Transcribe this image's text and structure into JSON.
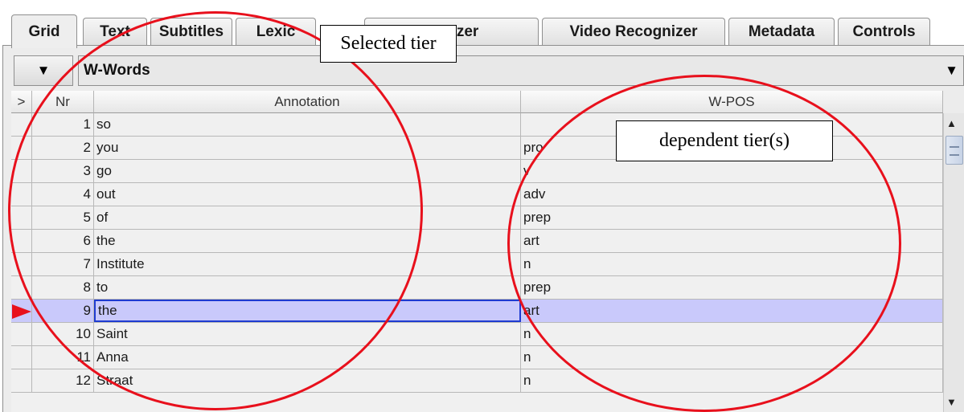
{
  "tabs": [
    {
      "label": "Grid",
      "active": true
    },
    {
      "label": "Text"
    },
    {
      "label": "Subtitles"
    },
    {
      "label": "Lexic"
    },
    {
      "label": "ognizer"
    },
    {
      "label": "Video Recognizer"
    },
    {
      "label": "Metadata"
    },
    {
      "label": "Controls"
    }
  ],
  "tier_selector": {
    "menu_glyph": "▼",
    "value": "W-Words",
    "arrow": "▼"
  },
  "table": {
    "columns": [
      ">",
      "Nr",
      "Annotation",
      "W-POS"
    ],
    "rows": [
      {
        "nr": "1",
        "annotation": "so",
        "pos": ""
      },
      {
        "nr": "2",
        "annotation": "you",
        "pos": "pro"
      },
      {
        "nr": "3",
        "annotation": "go",
        "pos": "v"
      },
      {
        "nr": "4",
        "annotation": "out",
        "pos": "adv"
      },
      {
        "nr": "5",
        "annotation": "of",
        "pos": "prep"
      },
      {
        "nr": "6",
        "annotation": "the",
        "pos": "art"
      },
      {
        "nr": "7",
        "annotation": "Institute",
        "pos": "n"
      },
      {
        "nr": "8",
        "annotation": "to",
        "pos": "prep"
      },
      {
        "nr": "9",
        "annotation": "the",
        "pos": "art",
        "selected": true
      },
      {
        "nr": "10",
        "annotation": "Saint",
        "pos": "n"
      },
      {
        "nr": "11",
        "annotation": "Anna",
        "pos": "n"
      },
      {
        "nr": "12",
        "annotation": "Straat",
        "pos": "n"
      }
    ]
  },
  "scrollbar": {
    "up_glyph": "▲",
    "down_glyph": "▼"
  },
  "callouts": {
    "selected_tier": "Selected tier",
    "dependent_tiers": "dependent tier(s)"
  },
  "colors": {
    "highlight_ring": "#e8101c",
    "selected_row": "#c9c9fb",
    "selected_cell_border": "#1e3bd1"
  }
}
